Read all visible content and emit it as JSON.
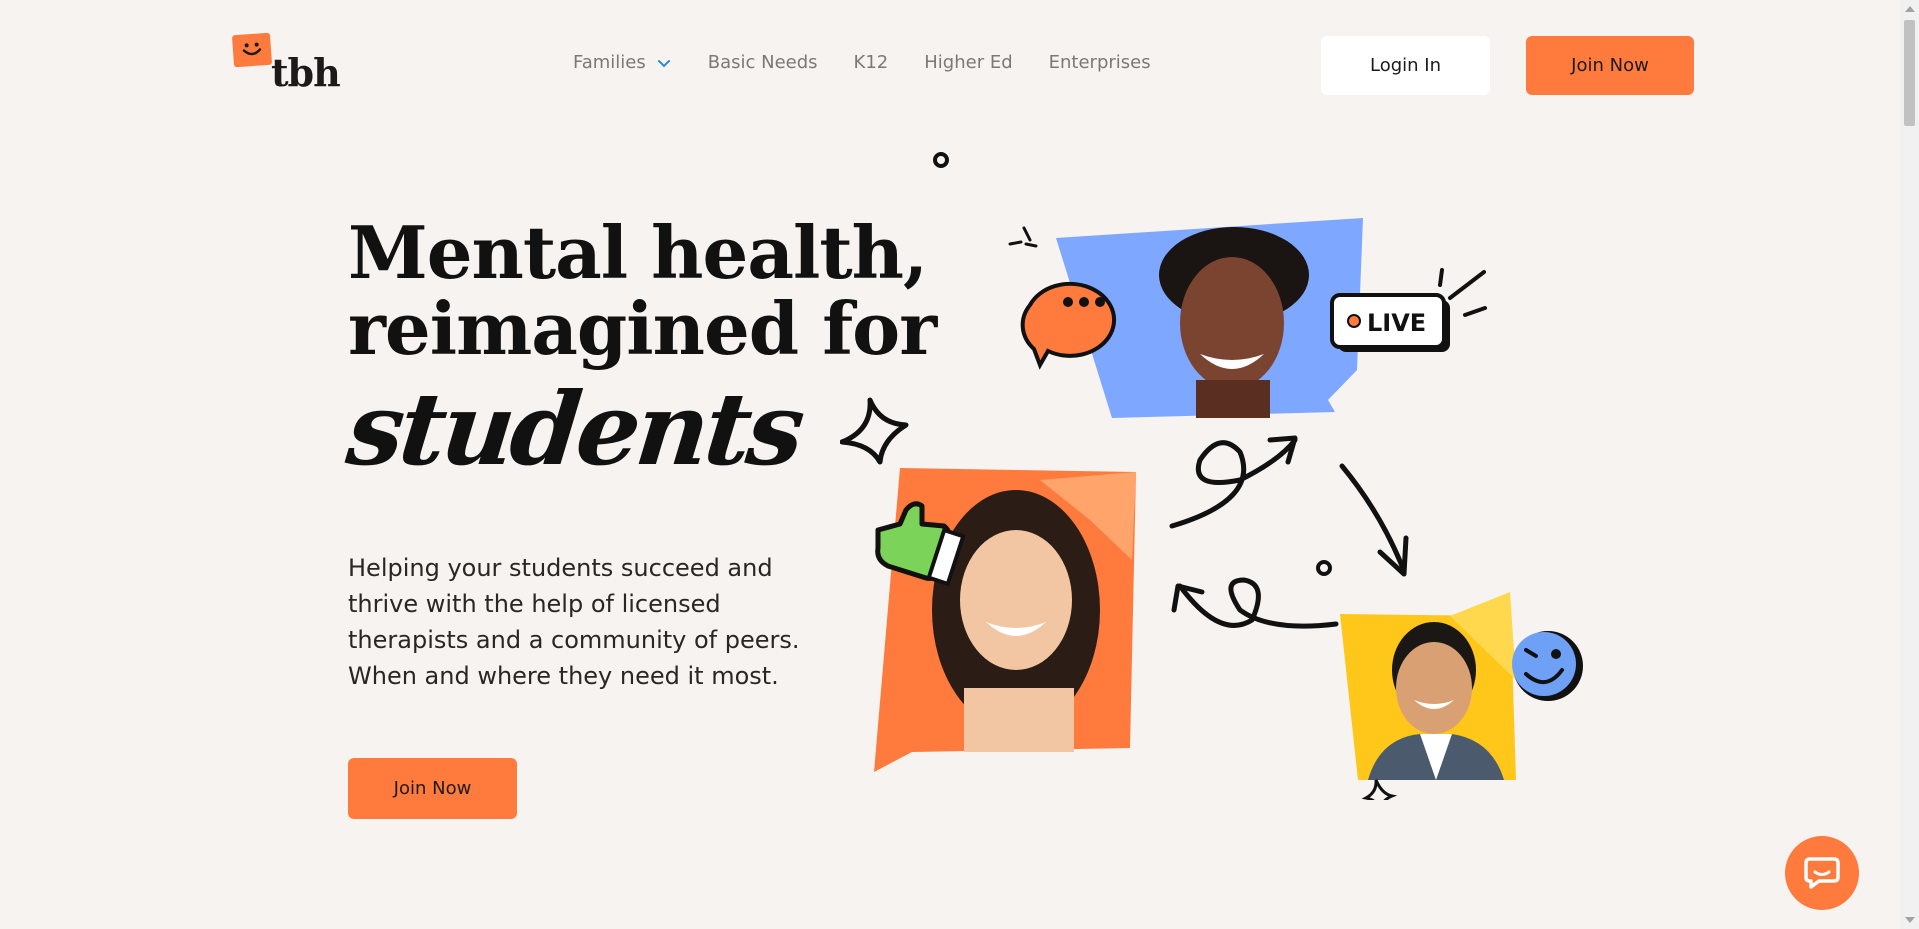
{
  "header": {
    "logo_text": "tbh",
    "nav": [
      {
        "label": "Families",
        "has_dropdown": true
      },
      {
        "label": "Basic Needs"
      },
      {
        "label": "K12"
      },
      {
        "label": "Higher Ed"
      },
      {
        "label": "Enterprises"
      }
    ],
    "login_label": "Login In",
    "join_label": "Join Now"
  },
  "hero": {
    "title_line1": "Mental health,",
    "title_line2": "reimagined for",
    "title_script": "students",
    "description": "Helping your students succeed and thrive with the help of licensed therapists and a community of peers. When and where they need it most.",
    "cta_label": "Join Now"
  },
  "illustration": {
    "live_badge": "LIVE",
    "icons": [
      "chat-bubble-icon",
      "thumbs-up-icon",
      "wink-face-icon",
      "sparkle-icon",
      "arrow-icon"
    ]
  },
  "colors": {
    "background": "#f7f3f1",
    "accent": "#ff7a3d",
    "blue": "#7ea7ff",
    "yellow": "#ffc71a",
    "text": "#111111",
    "nav_text": "#7d7775"
  }
}
